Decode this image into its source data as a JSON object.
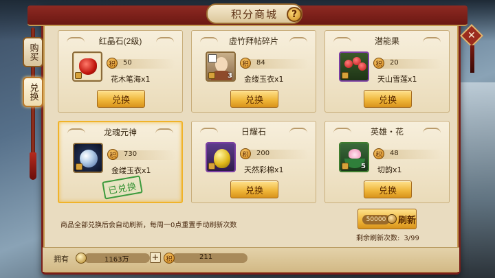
{
  "header": {
    "title": "积分商城",
    "help_icon_label": "?"
  },
  "side_tabs": [
    {
      "label": "购买",
      "active": false
    },
    {
      "label": "兑换",
      "active": true
    }
  ],
  "close_label": "✕",
  "point_glyph": "积",
  "items": [
    {
      "name": "红晶石(2级)",
      "cost": "50",
      "reward": "花木笔海x1",
      "button": "兑换",
      "icon": "ruby-icon",
      "redeemed": false,
      "qty": ""
    },
    {
      "name": "虚竹拜帖碎片",
      "cost": "84",
      "reward": "金缕玉衣x1",
      "button": "兑换",
      "icon": "monk-portrait-icon",
      "redeemed": false,
      "qty": "3"
    },
    {
      "name": "潜能果",
      "cost": "20",
      "reward": "天山雪莲x1",
      "button": "兑换",
      "icon": "red-fruit-icon",
      "redeemed": false,
      "qty": ""
    },
    {
      "name": "龙魂元神",
      "cost": "730",
      "reward": "金缕玉衣x1",
      "button": "兑换",
      "icon": "spirit-orb-icon",
      "redeemed": true,
      "qty": ""
    },
    {
      "name": "日耀石",
      "cost": "200",
      "reward": "天然彩棉x1",
      "button": "兑换",
      "icon": "gold-stone-icon",
      "redeemed": false,
      "qty": ""
    },
    {
      "name": "英雄・花",
      "cost": "48",
      "reward": "切韵x1",
      "button": "兑换",
      "icon": "lotus-bowl-icon",
      "redeemed": false,
      "qty": "5"
    }
  ],
  "redeemed_stamp": "已兑换",
  "footer": {
    "hint": "商品全部兑换后会自动刷新，每周一0点重置手动刷新次数",
    "refresh_cost": "50000",
    "refresh_label": "刷新",
    "remaining_label": "剩余刷新次数:",
    "remaining_value": "3/99"
  },
  "bottom": {
    "own_label": "拥有",
    "silver": "1163万",
    "plus": "+",
    "points": "211"
  },
  "colors": {
    "frame": "#7a1f1a",
    "button": "#eeb437",
    "selected": "#f0b32a",
    "stamp": "#2f8f2f"
  }
}
